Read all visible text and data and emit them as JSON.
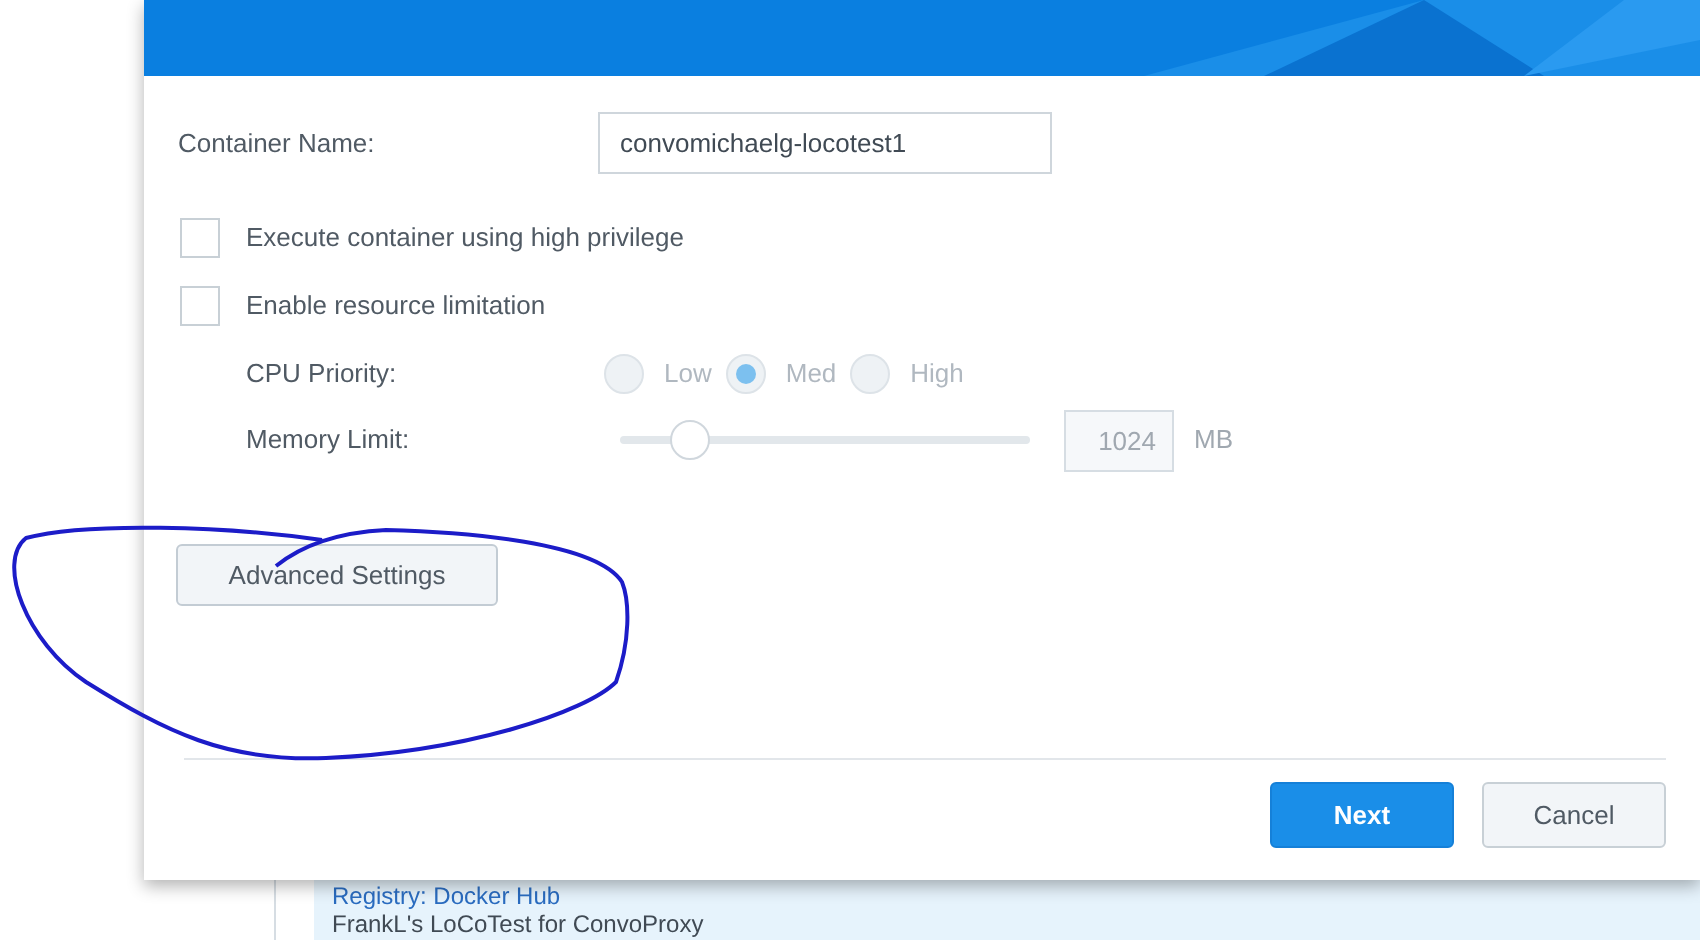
{
  "dialog": {
    "fields": [
      {
        "label": "Container Name:",
        "value": "convomichaelg-locotest1"
      }
    ],
    "checkboxes": [
      {
        "label": "Execute container using high privilege",
        "checked": false
      },
      {
        "label": "Enable resource limitation",
        "checked": false
      }
    ],
    "cpu_priority": {
      "label": "CPU Priority:",
      "disabled": true,
      "options": [
        {
          "label": "Low",
          "selected": false
        },
        {
          "label": "Med",
          "selected": true
        },
        {
          "label": "High",
          "selected": false
        }
      ]
    },
    "memory_limit": {
      "label": "Memory Limit:",
      "disabled": true,
      "level": 0.17,
      "value": "1024",
      "unit": "MB"
    },
    "advanced_button": "Advanced Settings",
    "buttons": [
      {
        "label": "Next",
        "kind": "primary"
      },
      {
        "label": "Cancel",
        "kind": "secondary"
      }
    ]
  },
  "background_list": {
    "items": [
      {
        "text": "Registry: Docker Hub",
        "kind": "link"
      },
      {
        "text": "FrankL's LoCoTest for ConvoProxy",
        "kind": "plain"
      }
    ]
  }
}
